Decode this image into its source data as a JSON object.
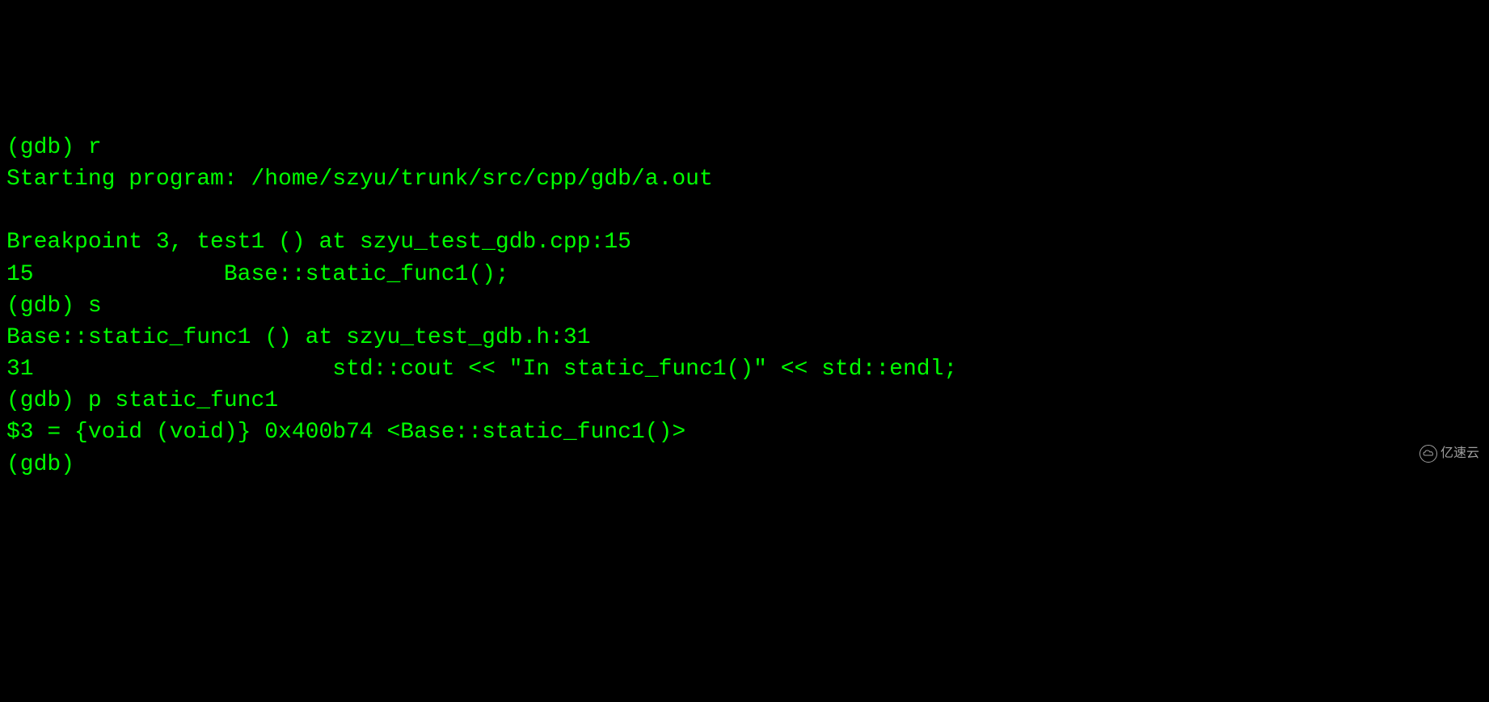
{
  "lines": [
    {
      "type": "prompt-input",
      "prompt": "(gdb) ",
      "input": "r"
    },
    {
      "type": "output",
      "text": "Starting program: /home/szyu/trunk/src/cpp/gdb/a.out"
    },
    {
      "type": "blank",
      "text": ""
    },
    {
      "type": "output",
      "text": "Breakpoint 3, test1 () at szyu_test_gdb.cpp:15"
    },
    {
      "type": "output",
      "text": "15              Base::static_func1();"
    },
    {
      "type": "prompt-input",
      "prompt": "(gdb) ",
      "input": "s"
    },
    {
      "type": "output",
      "text": "Base::static_func1 () at szyu_test_gdb.h:31"
    },
    {
      "type": "output",
      "text": "31                      std::cout << \"In static_func1()\" << std::endl;"
    },
    {
      "type": "prompt-input",
      "prompt": "(gdb) ",
      "input": "p static_func1"
    },
    {
      "type": "output",
      "text": "$3 = {void (void)} 0x400b74 <Base::static_func1()>"
    },
    {
      "type": "prompt-input",
      "prompt": "(gdb) ",
      "input": ""
    }
  ],
  "watermark": {
    "text": "亿速云"
  }
}
